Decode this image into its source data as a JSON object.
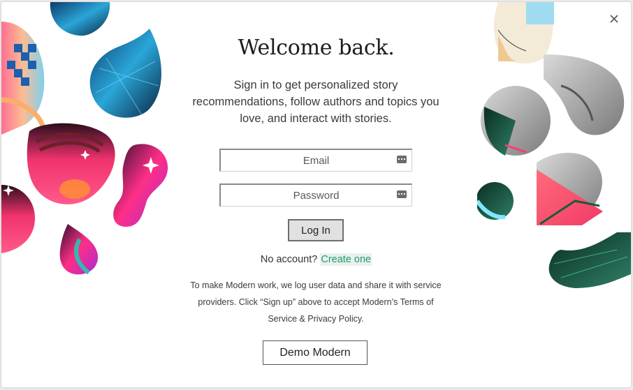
{
  "dialog": {
    "title": "Welcome back.",
    "subtitle": "Sign in to get personalized story recommendations, follow authors and topics you love, and interact with stories.",
    "close_icon": "close-icon",
    "close_glyph": "×"
  },
  "form": {
    "email_placeholder": "Email",
    "password_placeholder": "Password",
    "login_label": "Log In",
    "field_icon": "password-manager-key-icon"
  },
  "account": {
    "prompt": "No account?",
    "create_link": "Create one"
  },
  "disclaimer": "To make Modern work, we log user data and share it with service providers. Click “Sign up” above to accept Modern’s Terms of Service & Privacy Policy.",
  "demo_button_label": "Demo Modern",
  "colors": {
    "link": "#1f9b6a",
    "link_bg": "#e8f1ed",
    "accent_pink": "#f0336e",
    "accent_teal": "#2a7a62",
    "accent_blue": "#1b6fb8"
  }
}
